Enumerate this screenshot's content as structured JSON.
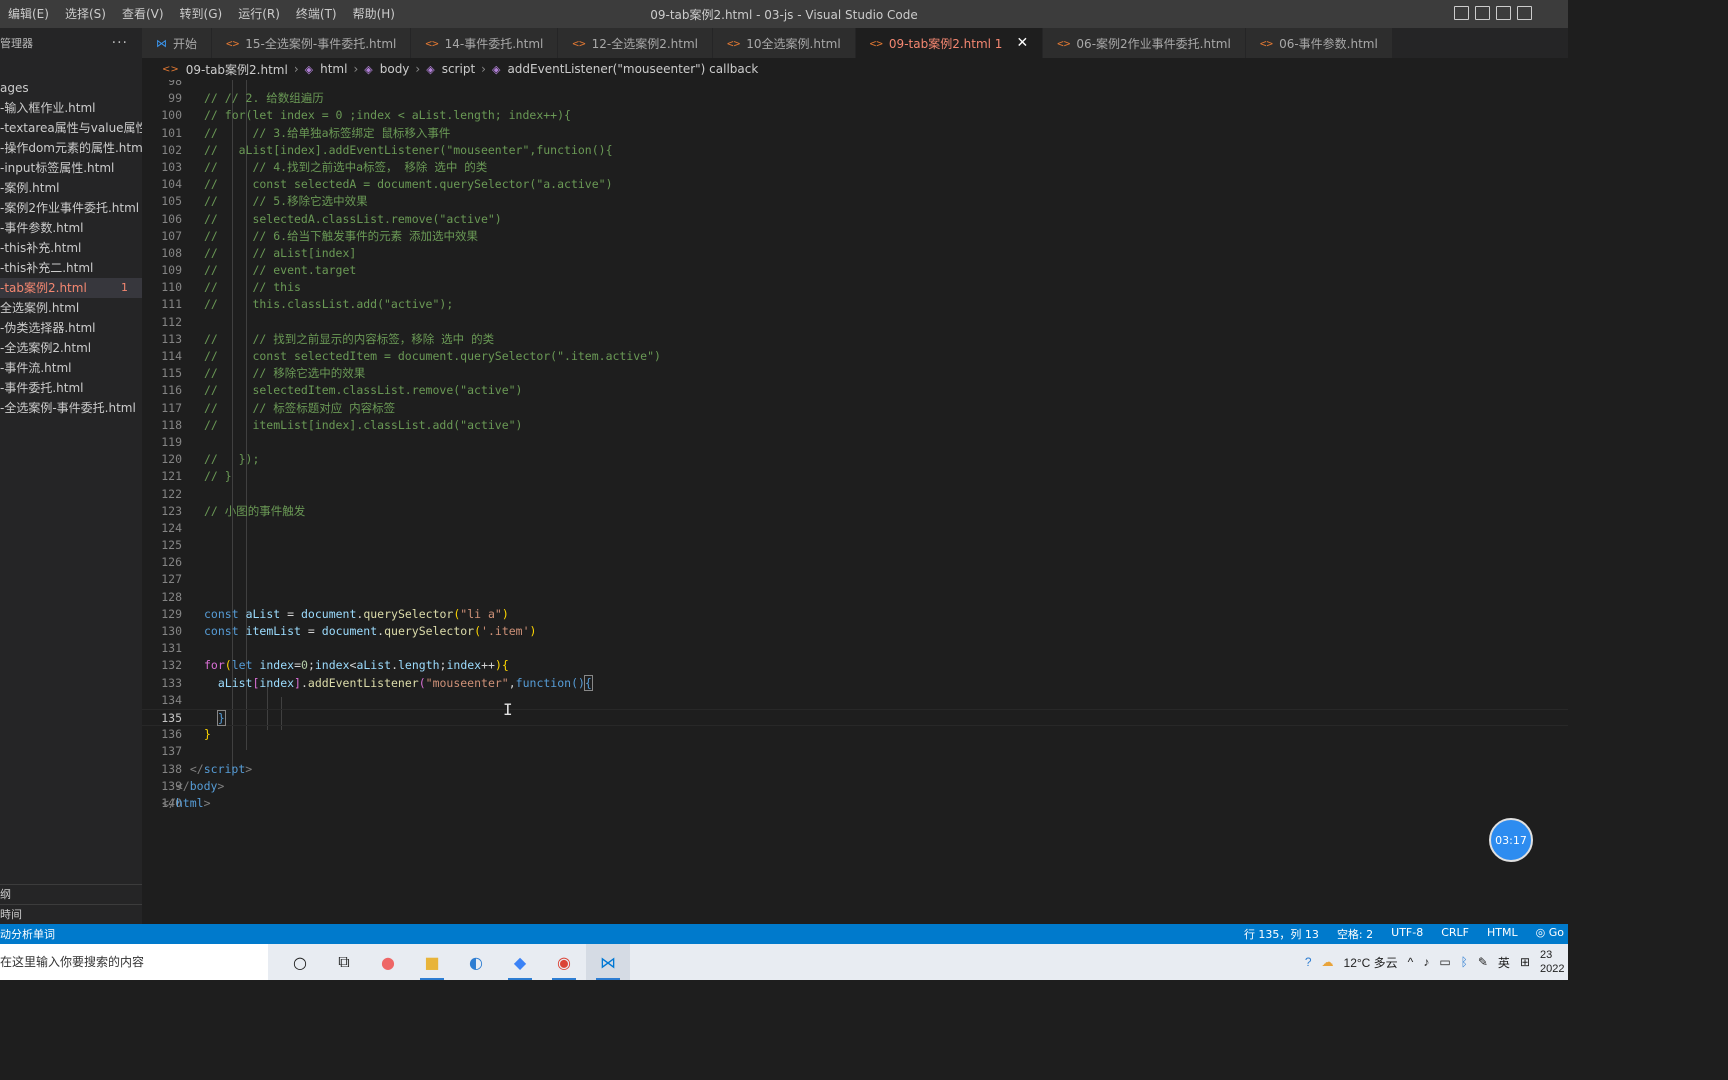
{
  "menu": [
    "编辑(E)",
    "选择(S)",
    "查看(V)",
    "转到(G)",
    "运行(R)",
    "终端(T)",
    "帮助(H)"
  ],
  "window_title": "09-tab案例2.html - 03-js - Visual Studio Code",
  "sidebar": {
    "title": "管理器",
    "folder": "ages",
    "files": [
      "-输入框作业.html",
      "-textarea属性与value属性...",
      "-操作dom元素的属性.html",
      "-input标签属性.html",
      "-案例.html",
      "-案例2作业事件委托.html",
      "-事件参数.html",
      "-this补充.html",
      "-this补充二.html",
      "-tab案例2.html",
      "全选案例.html",
      "-伪类选择器.html",
      "-全选案例2.html",
      "-事件流.html",
      "-事件委托.html",
      "-全选案例-事件委托.html"
    ],
    "active_badge": "1",
    "bottom_sections": [
      "纲",
      "時间"
    ]
  },
  "tabs": [
    {
      "label": "开始",
      "icon": "vscode-icon"
    },
    {
      "label": "15-全选案例-事件委托.html",
      "icon": "html-icon"
    },
    {
      "label": "14-事件委托.html",
      "icon": "html-icon"
    },
    {
      "label": "12-全选案例2.html",
      "icon": "html-icon"
    },
    {
      "label": "10全选案例.html",
      "icon": "html-icon"
    },
    {
      "label": "09-tab案例2.html 1",
      "icon": "html-icon"
    },
    {
      "label": "06-案例2作业事件委托.html",
      "icon": "html-icon"
    },
    {
      "label": "06-事件参数.html",
      "icon": "html-icon"
    }
  ],
  "breadcrumb": [
    "09-tab案例2.html",
    "html",
    "body",
    "script",
    "addEventListener(\"mouseenter\") callback"
  ],
  "editor": {
    "first_line": 98,
    "current_line": 135,
    "last_line": 140
  },
  "timer": "03:17",
  "status": {
    "left": "动分析单词",
    "position": "行 135，列 13",
    "spaces": "空格: 2",
    "encoding": "UTF-8",
    "eol": "CRLF",
    "language": "HTML",
    "go": "Go"
  },
  "taskbar": {
    "search_placeholder": "在这里输入你要搜索的内容",
    "weather": "12°C 多云",
    "ime": "英",
    "clock_time": "23",
    "clock_date": "2022"
  }
}
